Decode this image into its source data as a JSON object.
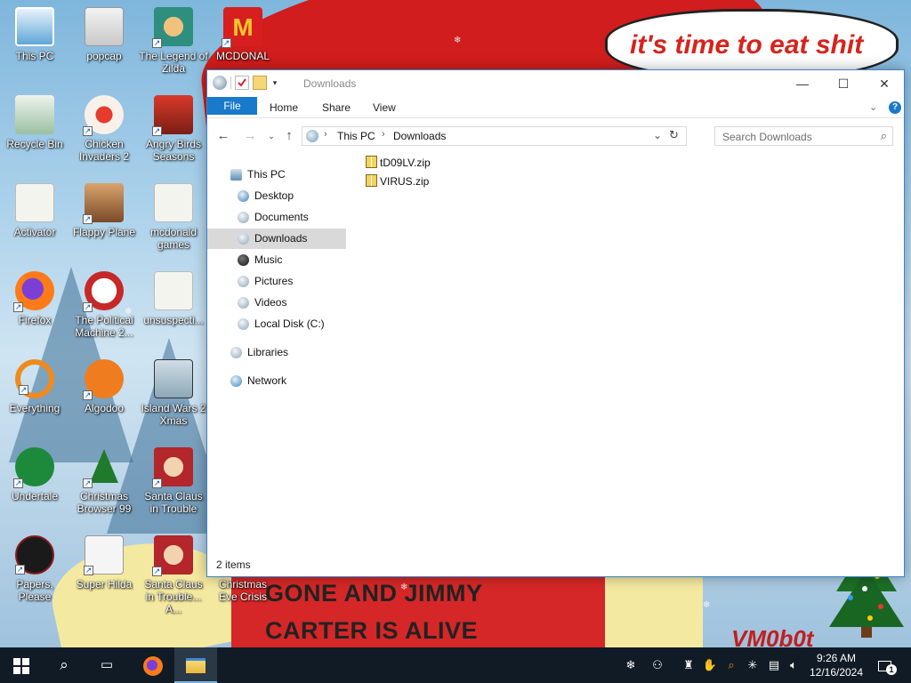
{
  "wallpaper": {
    "bubble_text": "it's time to eat shit",
    "shirt_line1": "GONE AND JIMMY",
    "shirt_line2": "CARTER IS ALIVE",
    "signature": "VM0b0t"
  },
  "desktop_icons": [
    {
      "label": "This PC",
      "name": "this-pc"
    },
    {
      "label": "popcap",
      "name": "popcap"
    },
    {
      "label": "The Legend of Zilda",
      "name": "legend-of-zilda"
    },
    {
      "label": "MCDONAL",
      "name": "mcdonalds"
    },
    {
      "label": "Recycle Bin",
      "name": "recycle-bin"
    },
    {
      "label": "Chicken Invaders 2",
      "name": "chicken-invaders-2"
    },
    {
      "label": "Angry Birds Seasons",
      "name": "angry-birds-seasons"
    },
    {
      "label": "Activator",
      "name": "activator"
    },
    {
      "label": "Flappy Plane",
      "name": "flappy-plane"
    },
    {
      "label": "mcdonald games",
      "name": "mcdonald-games"
    },
    {
      "label": "Firefox",
      "name": "firefox"
    },
    {
      "label": "The Political Machine 2...",
      "name": "political-machine"
    },
    {
      "label": "unsuspecti...",
      "name": "unsuspecti"
    },
    {
      "label": "Everything",
      "name": "everything"
    },
    {
      "label": "Algodoo",
      "name": "algodoo"
    },
    {
      "label": "Island Wars 2 Xmas",
      "name": "island-wars-2-xmas"
    },
    {
      "label": "Undertale",
      "name": "undertale"
    },
    {
      "label": "Christmas Browser 99",
      "name": "christmas-browser-99"
    },
    {
      "label": "Santa Claus in Trouble",
      "name": "santa-claus-in-trouble"
    },
    {
      "label": "Papers, Please",
      "name": "papers-please"
    },
    {
      "label": "Super Hilda",
      "name": "super-hilda"
    },
    {
      "label": "Santa Claus in Trouble... A...",
      "name": "santa-claus-in-trouble-2"
    },
    {
      "label": "Christmas Eve Crisis",
      "name": "christmas-eve-crisis"
    }
  ],
  "explorer": {
    "title": "Downloads",
    "tabs": {
      "file": "File",
      "home": "Home",
      "share": "Share",
      "view": "View"
    },
    "address": {
      "root": "This PC",
      "current": "Downloads"
    },
    "search_placeholder": "Search Downloads",
    "nav": {
      "this_pc": "This PC",
      "desktop": "Desktop",
      "documents": "Documents",
      "downloads": "Downloads",
      "music": "Music",
      "pictures": "Pictures",
      "videos": "Videos",
      "local_disk": "Local Disk (C:)",
      "libraries": "Libraries",
      "network": "Network"
    },
    "files": [
      {
        "name": "tD09LV.zip"
      },
      {
        "name": "VIRUS.zip"
      }
    ],
    "status": "2 items"
  },
  "taskbar": {
    "time": "9:26 AM",
    "date": "12/16/2024",
    "notification_count": "1"
  },
  "colors": {
    "accent": "#1979ca",
    "taskbar": "#101b25",
    "selection": "#d9d9d9"
  }
}
